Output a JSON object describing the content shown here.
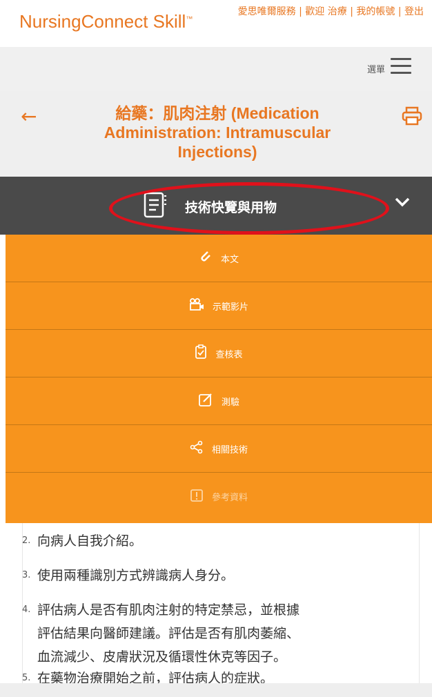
{
  "header": {
    "logo": "NursingConnect Skill",
    "logo_tm": "™",
    "links": [
      "愛思唯爾服務",
      "歡迎 治療",
      "我的帳號",
      "登出"
    ],
    "sep": "|"
  },
  "menubar": {
    "label": "選單",
    "icon": "hamburger-icon"
  },
  "titlebar": {
    "back_icon": "back-arrow-icon",
    "title": "給藥：肌肉注射 (Medication Administration: Intramuscular Injections)",
    "print_icon": "printer-icon"
  },
  "section": {
    "label": "技術快覽與用物",
    "icon": "document-icon",
    "toggle_icon": "chevron-down-icon"
  },
  "menu": [
    {
      "label": "本文",
      "icon": "paperclip-icon"
    },
    {
      "label": "示範影片",
      "icon": "video-camera-icon"
    },
    {
      "label": "查核表",
      "icon": "clipboard-check-icon"
    },
    {
      "label": "測驗",
      "icon": "edit-icon"
    },
    {
      "label": "相關技術",
      "icon": "share-icon"
    },
    {
      "label": "參考資料",
      "icon": "reference-icon"
    }
  ],
  "steps": [
    {
      "num": "2.",
      "lines": [
        "向病人自我介紹。"
      ]
    },
    {
      "num": "3.",
      "lines": [
        "使用兩種識別方式辨識病人身分。"
      ]
    },
    {
      "num": "4.",
      "lines": [
        "評估病人是否有肌肉注射的特定禁忌，並根據",
        "評估結果向醫師建議。評估是否有肌肉萎縮、",
        "血流減少、皮膚狀況及循環性休克等因子。"
      ]
    },
    {
      "num": "5.",
      "lines": [
        "在藥物治療開始之前，評估病人的症狀。"
      ]
    }
  ],
  "colors": {
    "accent": "#e87722",
    "menu_bg": "#f7941d",
    "dark": "#4a4a4a",
    "highlight": "#e0111b"
  }
}
